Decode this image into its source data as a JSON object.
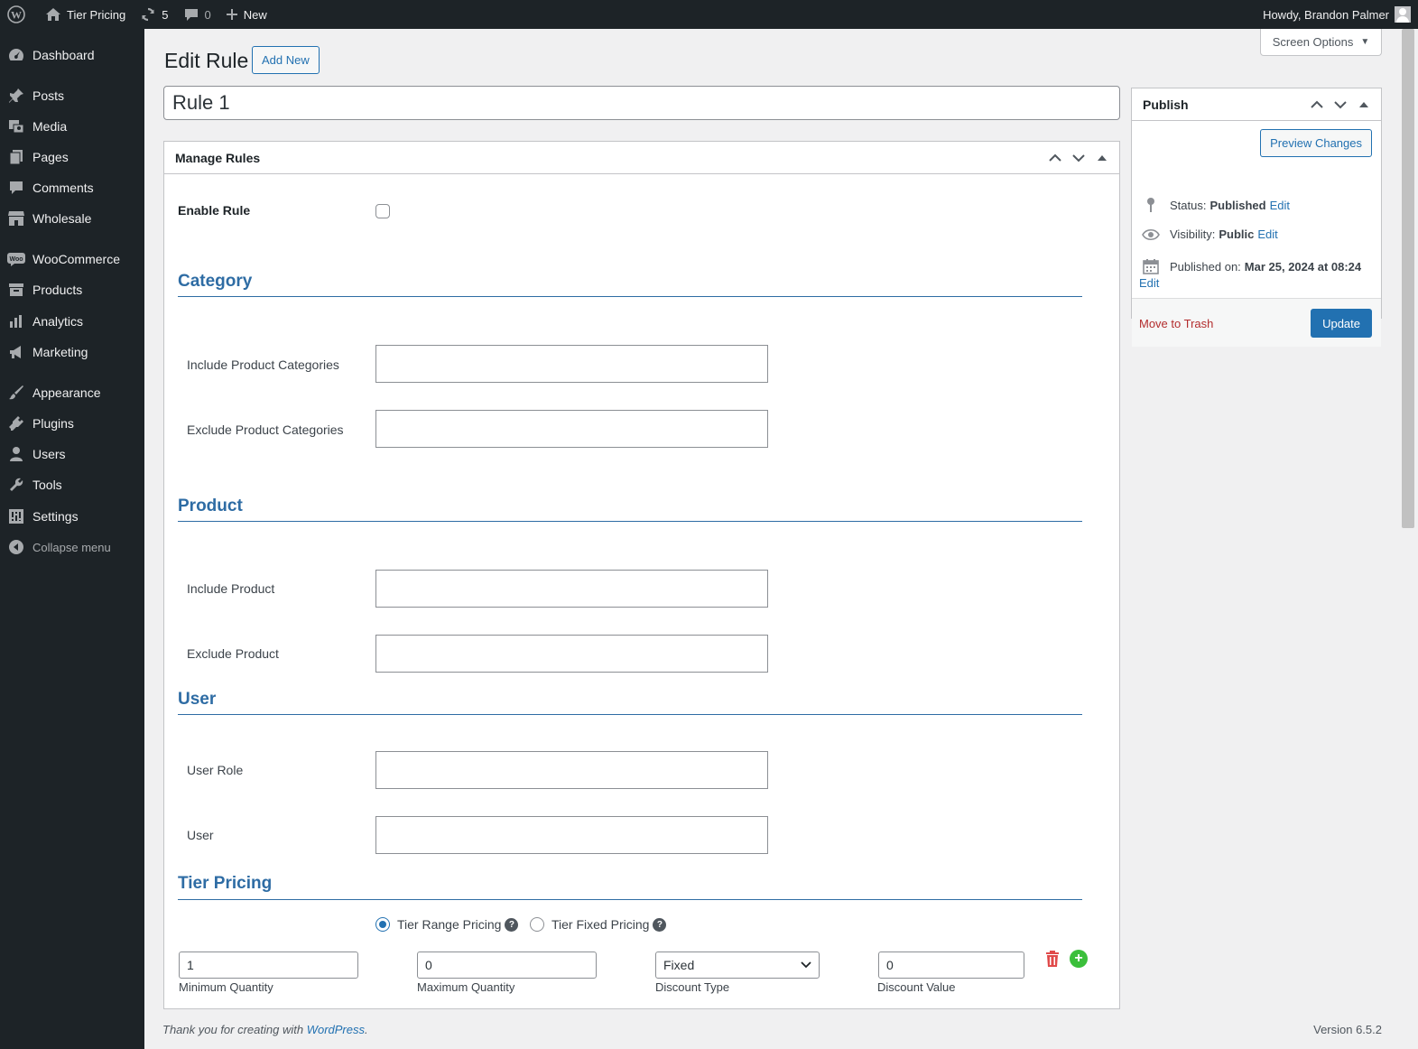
{
  "adminbar": {
    "site_name": "Tier Pricing",
    "updates_count": "5",
    "comments_count": "0",
    "new_label": "New",
    "greeting": "Howdy, Brandon Palmer"
  },
  "sidebar": {
    "items": [
      {
        "label": "Dashboard",
        "icon": "dashboard-icon"
      },
      {
        "label": "Posts",
        "icon": "pin-icon"
      },
      {
        "label": "Media",
        "icon": "media-icon"
      },
      {
        "label": "Pages",
        "icon": "pages-icon"
      },
      {
        "label": "Comments",
        "icon": "comments-icon"
      },
      {
        "label": "Wholesale",
        "icon": "store-icon"
      },
      {
        "label": "WooCommerce",
        "icon": "woo-icon"
      },
      {
        "label": "Products",
        "icon": "archive-icon"
      },
      {
        "label": "Analytics",
        "icon": "chart-icon"
      },
      {
        "label": "Marketing",
        "icon": "megaphone-icon"
      },
      {
        "label": "Appearance",
        "icon": "brush-icon"
      },
      {
        "label": "Plugins",
        "icon": "plugin-icon"
      },
      {
        "label": "Users",
        "icon": "user-icon"
      },
      {
        "label": "Tools",
        "icon": "wrench-icon"
      },
      {
        "label": "Settings",
        "icon": "settings-icon"
      }
    ],
    "collapse_label": "Collapse menu"
  },
  "header": {
    "screen_options": "Screen Options",
    "page_title": "Edit Rule",
    "add_new": "Add New"
  },
  "post_title": "Rule 1",
  "rules": {
    "box_title": "Manage Rules",
    "enable_label": "Enable Rule",
    "enabled": false,
    "category": {
      "title": "Category",
      "include_label": "Include Product Categories",
      "exclude_label": "Exclude Product Categories"
    },
    "product": {
      "title": "Product",
      "include_label": "Include Product",
      "exclude_label": "Exclude Product"
    },
    "user": {
      "title": "User",
      "role_label": "User Role",
      "user_label": "User"
    },
    "tier": {
      "title": "Tier Pricing",
      "range_label": "Tier Range Pricing",
      "fixed_label": "Tier Fixed Pricing",
      "selected": "Tier Range Pricing",
      "min_qty": "1",
      "max_qty": "0",
      "discount_type": "Fixed",
      "discount_value": "0",
      "min_label": "Minimum Quantity",
      "max_label": "Maximum Quantity",
      "type_label": "Discount Type",
      "value_label": "Discount Value"
    }
  },
  "publish": {
    "title": "Publish",
    "preview": "Preview Changes",
    "status_label": "Status:",
    "status_value": "Published",
    "visibility_label": "Visibility:",
    "visibility_value": "Public",
    "published_label": "Published on:",
    "published_value": "Mar 25, 2024 at 08:24",
    "edit": "Edit",
    "trash": "Move to Trash",
    "update": "Update"
  },
  "footer": {
    "thanks_prefix": "Thank you for creating with ",
    "thanks_link": "WordPress",
    "thanks_suffix": ".",
    "version": "Version 6.5.2"
  },
  "colors": {
    "admin_dark": "#1d2327",
    "accent": "#2271b1",
    "section_blue": "#2e6ca4",
    "trash_red": "#e04a4a",
    "add_green": "#3bbf3b"
  }
}
